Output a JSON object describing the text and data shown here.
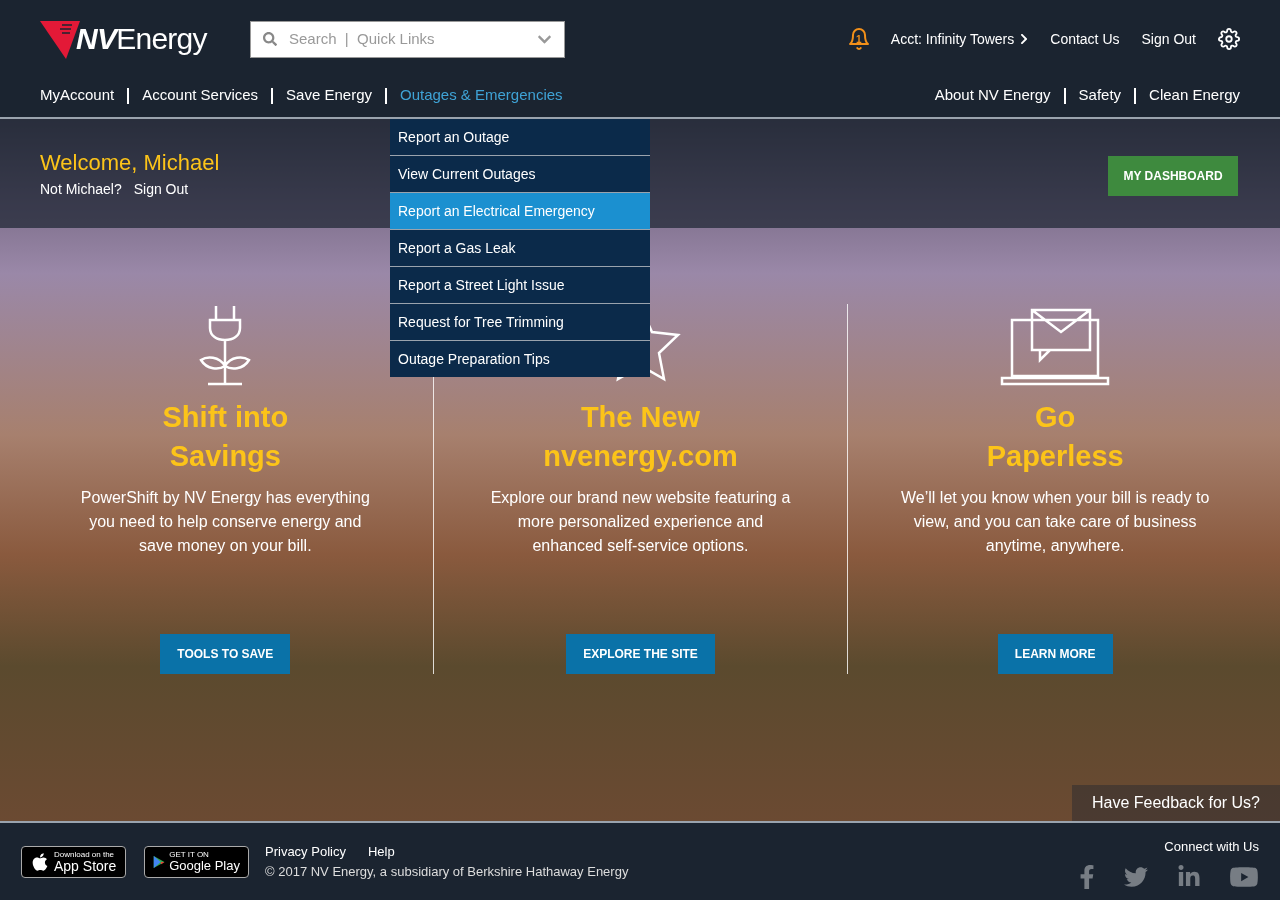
{
  "header": {
    "logo": {
      "bold": "NV",
      "rest": "Energy"
    },
    "search": {
      "placeholder": "Search  |  Quick Links"
    },
    "notifications": {
      "count": "1"
    },
    "account_link": "Acct: Infinity Towers",
    "links": [
      "Contact Us",
      "Sign Out"
    ]
  },
  "nav": {
    "left": [
      {
        "label": "MyAccount",
        "selected": false
      },
      {
        "label": "Account Services",
        "selected": false
      },
      {
        "label": "Save Energy",
        "selected": false
      },
      {
        "label": "Outages & Emergencies",
        "selected": true
      }
    ],
    "right": [
      "About NV Energy",
      "Safety",
      "Clean Energy"
    ]
  },
  "dropdown": [
    {
      "label": "Report an Outage",
      "selected": false
    },
    {
      "label": "View Current Outages",
      "selected": false
    },
    {
      "label": "Report an Electrical Emergency",
      "selected": true
    },
    {
      "label": "Report a Gas Leak",
      "selected": false
    },
    {
      "label": "Report a Street Light Issue",
      "selected": false
    },
    {
      "label": "Request for Tree Trimming",
      "selected": false
    },
    {
      "label": "Outage Preparation Tips",
      "selected": false
    }
  ],
  "welcome": {
    "greeting": "Welcome, Michael",
    "not_you": "Not Michael?",
    "sign_out": "Sign Out",
    "dashboard_button": "MY DASHBOARD"
  },
  "features": [
    {
      "kind": "plug",
      "title": [
        "Shift into",
        "Savings"
      ],
      "text": "PowerShift by NV Energy has everything you need to help conserve energy and save money on your bill.",
      "button": "TOOLS TO SAVE"
    },
    {
      "kind": "star",
      "title": [
        "The New",
        "nvenergy.com"
      ],
      "text": "Explore our brand new website featuring a more personalized experience and enhanced self-service options.",
      "button": "EXPLORE THE SITE"
    },
    {
      "kind": "laptop",
      "title": [
        "Go",
        "Paperless"
      ],
      "text": "We’ll let you know when your bill is ready to view, and you can take care of business anytime, anywhere.",
      "button": "LEARN MORE"
    }
  ],
  "feedback": "Have Feedback for Us?",
  "footer": {
    "app_store": {
      "small": "Download on the",
      "big": "App Store"
    },
    "google_play": {
      "small": "GET IT ON",
      "big": "Google Play"
    },
    "links": [
      "Privacy Policy",
      "Help"
    ],
    "copyright": "© 2017 NV Energy, a subsidiary of Berkshire Hathaway Energy",
    "connect": "Connect with Us"
  }
}
